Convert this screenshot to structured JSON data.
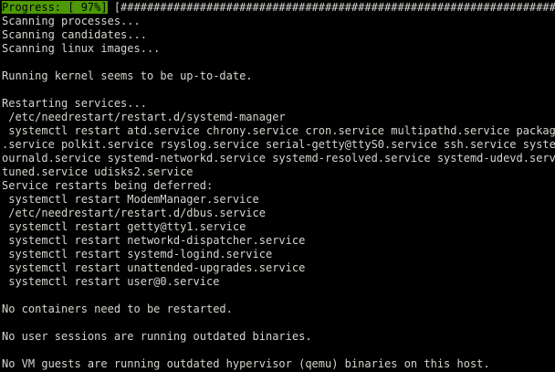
{
  "colors": {
    "background": "#000000",
    "text": "#d3d7cf",
    "progress_highlight": "#4e9a06",
    "progress_text": "#000000"
  },
  "progress": {
    "label": "Progress: [ 97%]",
    "percent": 97,
    "bar": " [##############################################################################"
  },
  "lines": [
    "Scanning processes...",
    "Scanning candidates...",
    "Scanning linux images...",
    "",
    "Running kernel seems to be up-to-date.",
    "",
    "Restarting services...",
    " /etc/needrestart/restart.d/systemd-manager",
    " systemctl restart atd.service chrony.service cron.service multipathd.service packagekit",
    ".service polkit.service rsyslog.service serial-getty@ttyS0.service ssh.service systemd-j",
    "ournald.service systemd-networkd.service systemd-resolved.service systemd-udevd.service",
    "tuned.service udisks2.service",
    "Service restarts being deferred:",
    " systemctl restart ModemManager.service",
    " /etc/needrestart/restart.d/dbus.service",
    " systemctl restart getty@tty1.service",
    " systemctl restart networkd-dispatcher.service",
    " systemctl restart systemd-logind.service",
    " systemctl restart unattended-upgrades.service",
    " systemctl restart user@0.service",
    "",
    "No containers need to be restarted.",
    "",
    "No user sessions are running outdated binaries.",
    "",
    "No VM guests are running outdated hypervisor (qemu) binaries on this host."
  ]
}
